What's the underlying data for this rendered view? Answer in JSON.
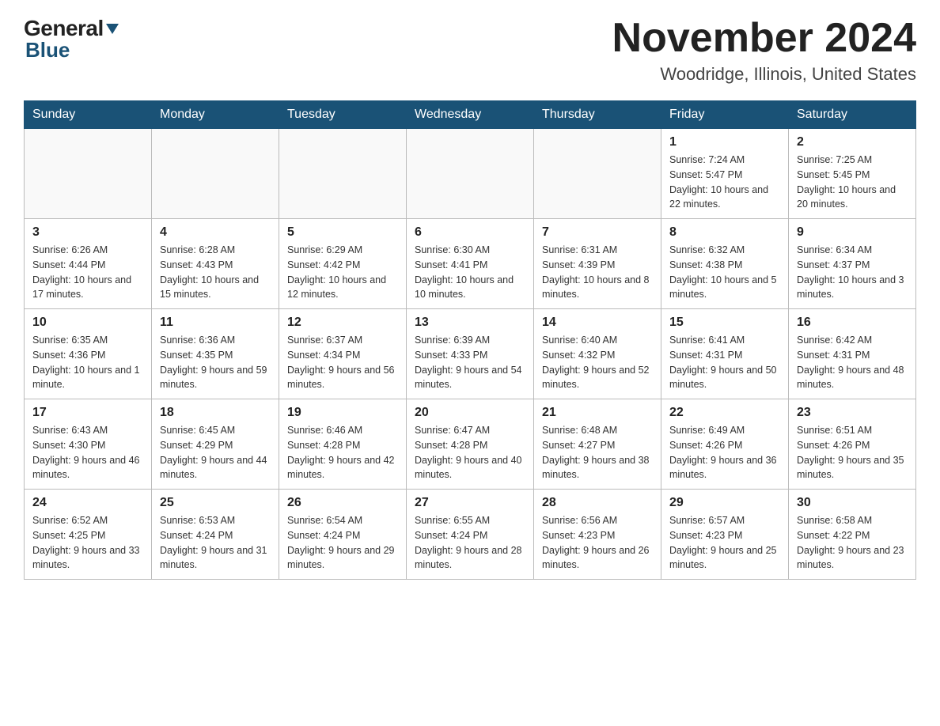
{
  "logo": {
    "general": "General",
    "blue": "Blue"
  },
  "header": {
    "month_year": "November 2024",
    "location": "Woodridge, Illinois, United States"
  },
  "days_of_week": [
    "Sunday",
    "Monday",
    "Tuesday",
    "Wednesday",
    "Thursday",
    "Friday",
    "Saturday"
  ],
  "weeks": [
    {
      "days": [
        {
          "number": "",
          "info": ""
        },
        {
          "number": "",
          "info": ""
        },
        {
          "number": "",
          "info": ""
        },
        {
          "number": "",
          "info": ""
        },
        {
          "number": "",
          "info": ""
        },
        {
          "number": "1",
          "info": "Sunrise: 7:24 AM\nSunset: 5:47 PM\nDaylight: 10 hours and 22 minutes."
        },
        {
          "number": "2",
          "info": "Sunrise: 7:25 AM\nSunset: 5:45 PM\nDaylight: 10 hours and 20 minutes."
        }
      ]
    },
    {
      "days": [
        {
          "number": "3",
          "info": "Sunrise: 6:26 AM\nSunset: 4:44 PM\nDaylight: 10 hours and 17 minutes."
        },
        {
          "number": "4",
          "info": "Sunrise: 6:28 AM\nSunset: 4:43 PM\nDaylight: 10 hours and 15 minutes."
        },
        {
          "number": "5",
          "info": "Sunrise: 6:29 AM\nSunset: 4:42 PM\nDaylight: 10 hours and 12 minutes."
        },
        {
          "number": "6",
          "info": "Sunrise: 6:30 AM\nSunset: 4:41 PM\nDaylight: 10 hours and 10 minutes."
        },
        {
          "number": "7",
          "info": "Sunrise: 6:31 AM\nSunset: 4:39 PM\nDaylight: 10 hours and 8 minutes."
        },
        {
          "number": "8",
          "info": "Sunrise: 6:32 AM\nSunset: 4:38 PM\nDaylight: 10 hours and 5 minutes."
        },
        {
          "number": "9",
          "info": "Sunrise: 6:34 AM\nSunset: 4:37 PM\nDaylight: 10 hours and 3 minutes."
        }
      ]
    },
    {
      "days": [
        {
          "number": "10",
          "info": "Sunrise: 6:35 AM\nSunset: 4:36 PM\nDaylight: 10 hours and 1 minute."
        },
        {
          "number": "11",
          "info": "Sunrise: 6:36 AM\nSunset: 4:35 PM\nDaylight: 9 hours and 59 minutes."
        },
        {
          "number": "12",
          "info": "Sunrise: 6:37 AM\nSunset: 4:34 PM\nDaylight: 9 hours and 56 minutes."
        },
        {
          "number": "13",
          "info": "Sunrise: 6:39 AM\nSunset: 4:33 PM\nDaylight: 9 hours and 54 minutes."
        },
        {
          "number": "14",
          "info": "Sunrise: 6:40 AM\nSunset: 4:32 PM\nDaylight: 9 hours and 52 minutes."
        },
        {
          "number": "15",
          "info": "Sunrise: 6:41 AM\nSunset: 4:31 PM\nDaylight: 9 hours and 50 minutes."
        },
        {
          "number": "16",
          "info": "Sunrise: 6:42 AM\nSunset: 4:31 PM\nDaylight: 9 hours and 48 minutes."
        }
      ]
    },
    {
      "days": [
        {
          "number": "17",
          "info": "Sunrise: 6:43 AM\nSunset: 4:30 PM\nDaylight: 9 hours and 46 minutes."
        },
        {
          "number": "18",
          "info": "Sunrise: 6:45 AM\nSunset: 4:29 PM\nDaylight: 9 hours and 44 minutes."
        },
        {
          "number": "19",
          "info": "Sunrise: 6:46 AM\nSunset: 4:28 PM\nDaylight: 9 hours and 42 minutes."
        },
        {
          "number": "20",
          "info": "Sunrise: 6:47 AM\nSunset: 4:28 PM\nDaylight: 9 hours and 40 minutes."
        },
        {
          "number": "21",
          "info": "Sunrise: 6:48 AM\nSunset: 4:27 PM\nDaylight: 9 hours and 38 minutes."
        },
        {
          "number": "22",
          "info": "Sunrise: 6:49 AM\nSunset: 4:26 PM\nDaylight: 9 hours and 36 minutes."
        },
        {
          "number": "23",
          "info": "Sunrise: 6:51 AM\nSunset: 4:26 PM\nDaylight: 9 hours and 35 minutes."
        }
      ]
    },
    {
      "days": [
        {
          "number": "24",
          "info": "Sunrise: 6:52 AM\nSunset: 4:25 PM\nDaylight: 9 hours and 33 minutes."
        },
        {
          "number": "25",
          "info": "Sunrise: 6:53 AM\nSunset: 4:24 PM\nDaylight: 9 hours and 31 minutes."
        },
        {
          "number": "26",
          "info": "Sunrise: 6:54 AM\nSunset: 4:24 PM\nDaylight: 9 hours and 29 minutes."
        },
        {
          "number": "27",
          "info": "Sunrise: 6:55 AM\nSunset: 4:24 PM\nDaylight: 9 hours and 28 minutes."
        },
        {
          "number": "28",
          "info": "Sunrise: 6:56 AM\nSunset: 4:23 PM\nDaylight: 9 hours and 26 minutes."
        },
        {
          "number": "29",
          "info": "Sunrise: 6:57 AM\nSunset: 4:23 PM\nDaylight: 9 hours and 25 minutes."
        },
        {
          "number": "30",
          "info": "Sunrise: 6:58 AM\nSunset: 4:22 PM\nDaylight: 9 hours and 23 minutes."
        }
      ]
    }
  ]
}
